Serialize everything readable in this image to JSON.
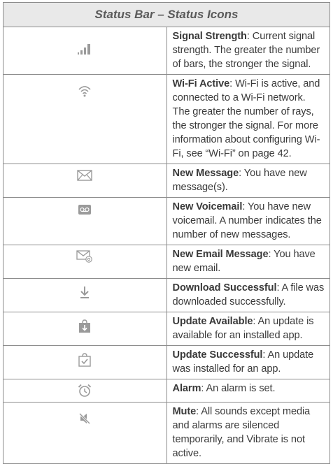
{
  "table": {
    "title": "Status Bar – Status Icons",
    "rows": [
      {
        "icon": "signal-strength-icon",
        "term": "Signal Strength",
        "text": ": Current signal strength. The greater the number of bars, the stronger the signal."
      },
      {
        "icon": "wifi-icon",
        "term": "Wi-Fi Active",
        "text": ": Wi-Fi is active, and connected to a Wi-Fi network. The greater the number of rays, the stronger the signal. For more information about configuring Wi-Fi, see “Wi-Fi” on page 42."
      },
      {
        "icon": "envelope-icon",
        "term": "New Message",
        "text": ": You have new message(s)."
      },
      {
        "icon": "voicemail-icon",
        "term": "New Voicemail",
        "text": ": You have new voicemail. A number indicates the number of new messages."
      },
      {
        "icon": "email-icon",
        "term": "New Email Message",
        "text": ": You have new email."
      },
      {
        "icon": "download-icon",
        "term": "Download Successful",
        "text": ": A file was downloaded successfully."
      },
      {
        "icon": "update-available-icon",
        "term": "Update Available",
        "text": ": An update is available for an installed app."
      },
      {
        "icon": "update-successful-icon",
        "term": "Update Successful",
        "text": ": An update was installed for an app."
      },
      {
        "icon": "alarm-clock-icon",
        "term": "Alarm",
        "text": ": An alarm is set."
      },
      {
        "icon": "mute-icon",
        "term": "Mute",
        "text": ": All sounds except media and alarms are silenced temporarily, and Vibrate is not active."
      }
    ]
  },
  "colors": {
    "icon_gray": "#9a9a9a",
    "header_bg": "#e9e9e9",
    "border": "#8c8c8c"
  }
}
